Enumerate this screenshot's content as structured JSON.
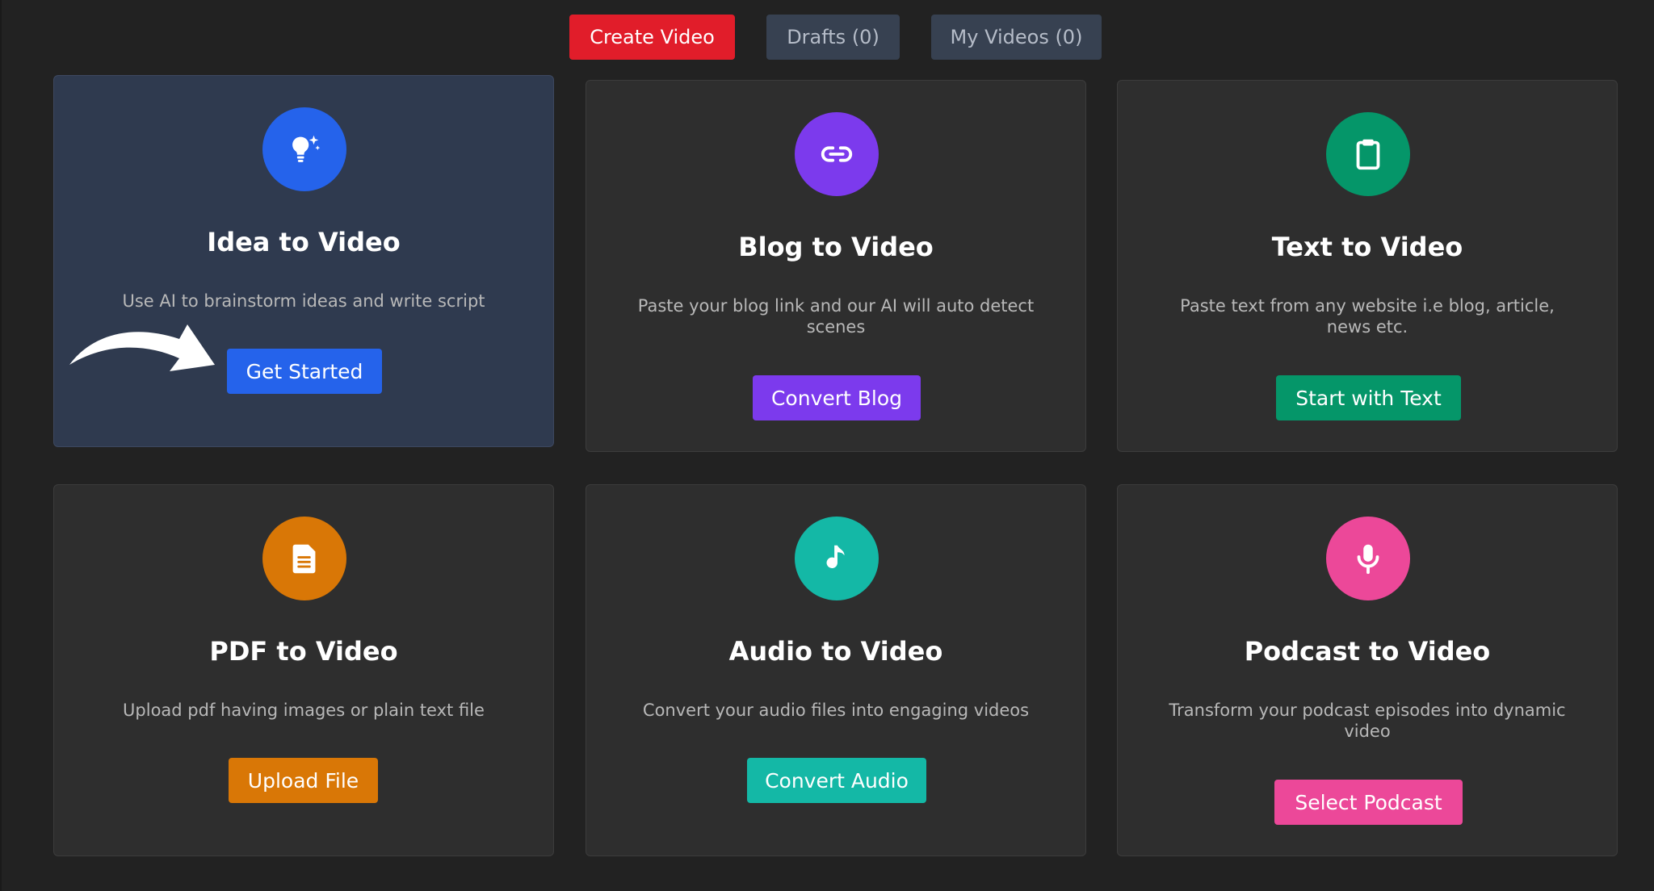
{
  "tabs": {
    "create": {
      "label": "Create Video",
      "color": "#e11d2a"
    },
    "drafts": {
      "label": "Drafts (0)",
      "color": "#374151"
    },
    "videos": {
      "label": "My Videos (0)",
      "color": "#374151"
    }
  },
  "cards": [
    {
      "title": "Idea to Video",
      "description": "Use AI to brainstorm ideas and write script",
      "button": "Get Started",
      "icon": "lightbulb-sparkle-icon",
      "color": "#2563eb"
    },
    {
      "title": "Blog to Video",
      "description": "Paste your blog link and our AI will auto detect scenes",
      "button": "Convert Blog",
      "icon": "link-icon",
      "color": "#7c3aed"
    },
    {
      "title": "Text to Video",
      "description": "Paste text from any website i.e blog, article, news etc.",
      "button": "Start with Text",
      "icon": "clipboard-icon",
      "color": "#059669"
    },
    {
      "title": "PDF to Video",
      "description": "Upload pdf having images or plain text file",
      "button": "Upload File",
      "icon": "document-icon",
      "color": "#d97706"
    },
    {
      "title": "Audio to Video",
      "description": "Convert your audio files into engaging videos",
      "button": "Convert Audio",
      "icon": "music-note-icon",
      "color": "#14b8a6"
    },
    {
      "title": "Podcast to Video",
      "description": "Transform your podcast episodes into dynamic video",
      "button": "Select Podcast",
      "icon": "microphone-icon",
      "color": "#ec4899"
    }
  ]
}
